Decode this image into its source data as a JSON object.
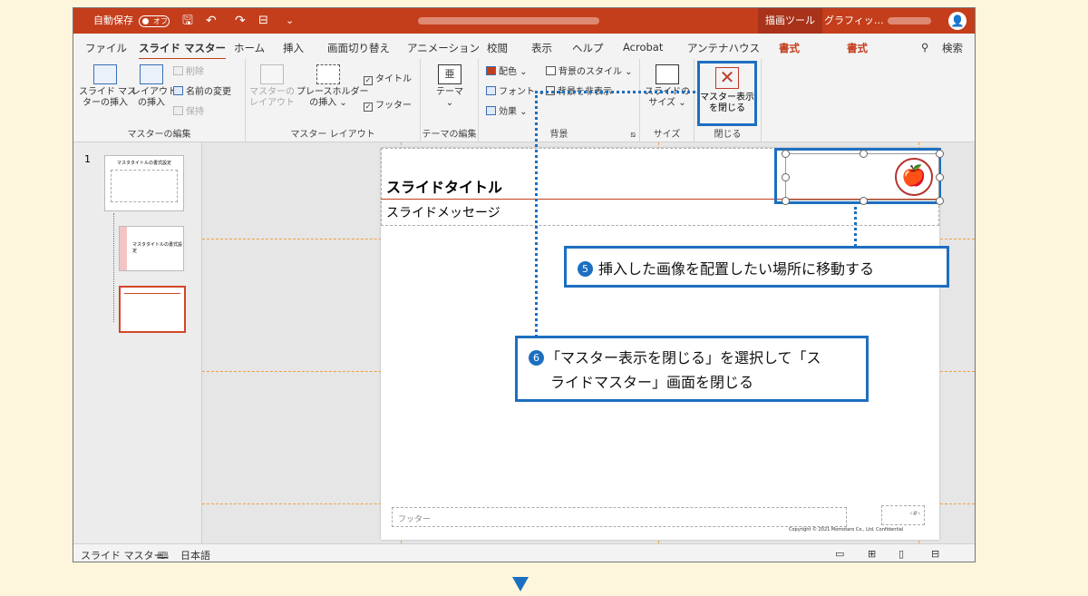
{
  "titlebar": {
    "autosave": "自動保存",
    "toggle": "オフ",
    "context_tab1": "描画ツール",
    "context_tab2": "グラフィッ…"
  },
  "tabs": [
    "ファイル",
    "スライド マスター",
    "ホーム",
    "挿入",
    "画面切り替え",
    "アニメーション",
    "校閲",
    "表示",
    "ヘルプ",
    "Acrobat",
    "アンテナハウス",
    "書式",
    "書式"
  ],
  "search": "検索",
  "ribbon": {
    "insert_master": [
      "スライド マス",
      "ターの挿入"
    ],
    "insert_layout": [
      "レイアウト",
      "の挿入"
    ],
    "delete": "削除",
    "rename": "名前の変更",
    "preserve": "保持",
    "group_master_edit": "マスターの編集",
    "master_layout": [
      "マスターの",
      "レイアウト"
    ],
    "placeholder": [
      "プレースホルダー",
      "の挿入 ⌄"
    ],
    "title_check": "タイトル",
    "footer_check": "フッター",
    "group_master_layout": "マスター レイアウト",
    "theme": [
      "テーマ",
      "⌄"
    ],
    "group_theme": "テーマの編集",
    "colors": "配色 ⌄",
    "fonts": "フォント ⌄",
    "effects": "効果 ⌄",
    "bg_style": "背景のスタイル ⌄",
    "hide_bg": "背景を非表示",
    "group_bg": "背景",
    "slide_size": [
      "スライドの",
      "サイズ ⌄"
    ],
    "group_size": "サイズ",
    "close_master": [
      "マスター表示",
      "を閉じる"
    ],
    "group_close": "閉じる"
  },
  "thumbs": {
    "number": "1",
    "t1_title": "マスタタイトルの書式設定",
    "t2_title": "マスタタイトルの書式設定"
  },
  "slide": {
    "title": "スライドタイトル",
    "message": "スライドメッセージ",
    "footer": "フッター",
    "page": "‹#›",
    "copyright": "Copyright © 2021 Momotaro Co., Ltd. Confidential"
  },
  "statusbar": {
    "mode": "スライド マスター",
    "language": "日本語"
  },
  "callouts": {
    "c5_num": "5",
    "c5_text": "挿入した画像を配置したい場所に移動する",
    "c6_num": "6",
    "c6_line1": "「マスター表示を閉じる」を選択して「ス",
    "c6_line2": "ライドマスター」画面を閉じる"
  }
}
